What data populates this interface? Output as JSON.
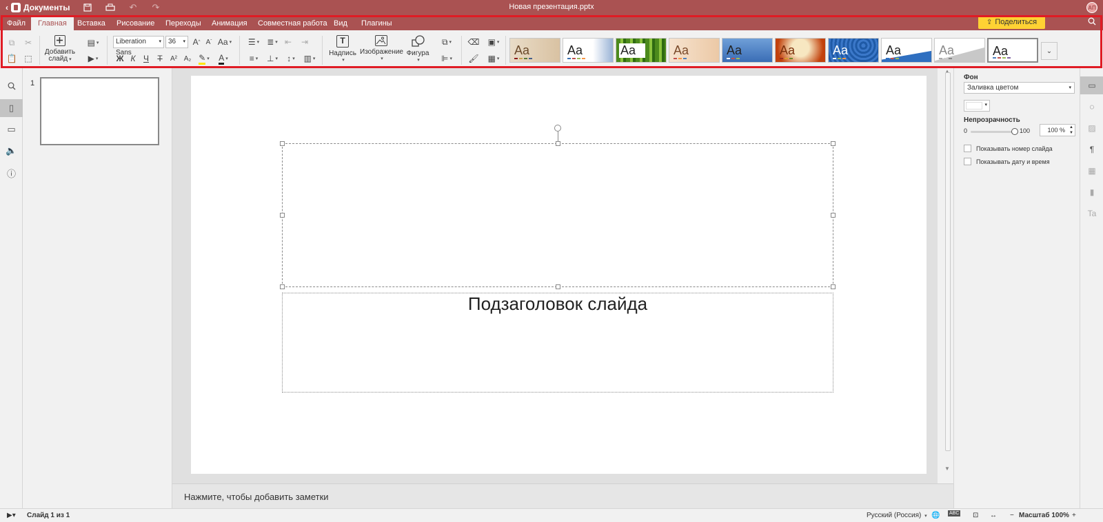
{
  "titlebar": {
    "back_label": "Документы",
    "document_title": "Новая презентация.pptx",
    "user_initials": "АП",
    "color": "#aa5252"
  },
  "tabs": [
    {
      "label": "Файл"
    },
    {
      "label": "Главная",
      "active": true
    },
    {
      "label": "Вставка"
    },
    {
      "label": "Рисование"
    },
    {
      "label": "Переходы"
    },
    {
      "label": "Анимация"
    },
    {
      "label": "Совместная работа"
    },
    {
      "label": "Вид"
    },
    {
      "label": "Плагины"
    }
  ],
  "share_button": {
    "label": "Поделиться",
    "color": "#ffd233"
  },
  "toolbar": {
    "add_slide_line1": "Добавить",
    "add_slide_line2": "слайд",
    "font_name": "Liberation Sans",
    "font_size": "36",
    "textbox_label": "Надпись",
    "image_label": "Изображение",
    "shape_label": "Фигура",
    "bold": "Ж",
    "italic": "К",
    "underline": "Ч",
    "strike": "Т",
    "theme_sample": "Aa"
  },
  "slides_panel": {
    "slide_number": "1"
  },
  "slide": {
    "subtitle": "Подзаголовок слайда"
  },
  "notes": {
    "placeholder": "Нажмите, чтобы добавить заметки"
  },
  "settings": {
    "background_label": "Фон",
    "fill_type": "Заливка цветом",
    "opacity_label": "Непрозрачность",
    "opacity_min": "0",
    "opacity_max": "100",
    "opacity_value": "100 %",
    "opacity_percent": 100,
    "show_slide_number": "Показывать номер слайда",
    "show_date_time": "Показывать дату и время"
  },
  "statusbar": {
    "slide_info": "Слайд 1 из 1",
    "language": "Русский (Россия)",
    "zoom": "Масштаб 100%"
  }
}
